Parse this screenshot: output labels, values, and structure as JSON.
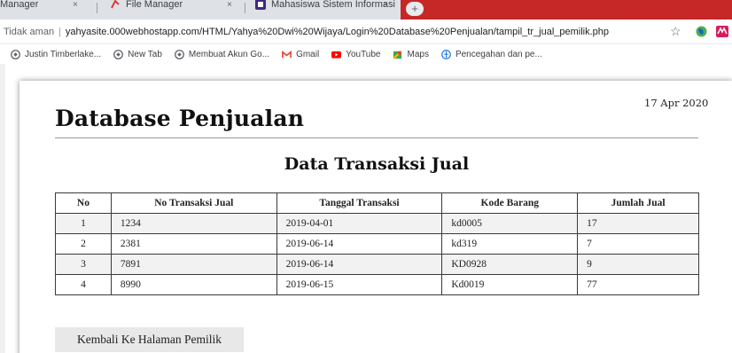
{
  "browser": {
    "tabs": [
      {
        "title": "Manager"
      },
      {
        "title": "File Manager"
      },
      {
        "title": "Mahasiswa Sistem Informasi"
      }
    ],
    "tab_close_glyph": "×",
    "new_tab_glyph": "+",
    "active_tab_color": "#c62828",
    "address_bar": {
      "security_label": "Tidak aman",
      "divider": "|",
      "url": "yahyasite.000webhostapp.com/HTML/Yahya%20Dwi%20Wijaya/Login%20Database%20Penjualan/tampil_tr_jual_pemilik.php"
    },
    "bookmarks": [
      {
        "label": "Justin Timberlake...",
        "icon": "globe-icon"
      },
      {
        "label": "New Tab",
        "icon": "globe-icon"
      },
      {
        "label": "Membuat Akun Go...",
        "icon": "globe-icon"
      },
      {
        "label": "Gmail",
        "icon": "gmail-icon"
      },
      {
        "label": "YouTube",
        "icon": "youtube-icon"
      },
      {
        "label": "Maps",
        "icon": "maps-icon"
      },
      {
        "label": "Pencegahan dan pe...",
        "icon": "who-icon"
      }
    ]
  },
  "page": {
    "date": "17 Apr 2020",
    "title": "Database Penjualan",
    "subtitle": "Data Transaksi Jual",
    "table": {
      "headers": [
        "No",
        "No Transaksi Jual",
        "Tanggal Transaksi",
        "Kode Barang",
        "Jumlah Jual"
      ],
      "rows": [
        [
          "1",
          "1234",
          "2019-04-01",
          "kd0005",
          "17"
        ],
        [
          "2",
          "2381",
          "2019-06-14",
          "kd319",
          "7"
        ],
        [
          "3",
          "7891",
          "2019-06-14",
          "KD0928",
          "9"
        ],
        [
          "4",
          "8990",
          "2019-06-15",
          "Kd0019",
          "77"
        ]
      ]
    },
    "back_button_label": "Kembali Ke Halaman Pemilik"
  }
}
